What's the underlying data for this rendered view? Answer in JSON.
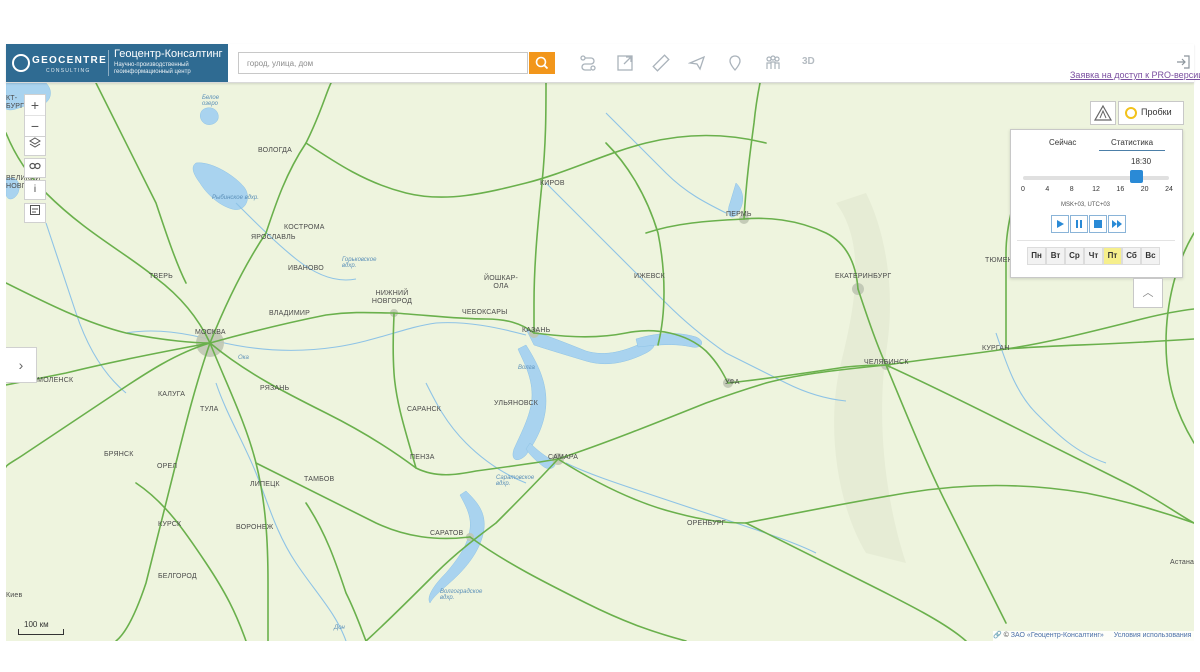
{
  "header": {
    "logo_word": "GEOCENTRE",
    "logo_sub": "CONSULTING",
    "company_name": "Геоцентр-Консалтинг",
    "company_desc": "Научно-производственный геоинформационный центр",
    "search_placeholder": "город, улица, дом",
    "tool_3d": "3D",
    "pro_link": "Заявка на доступ к PRO-версии"
  },
  "traffic": {
    "button_label": "Пробки",
    "tabs": [
      "Сейчас",
      "Статистика"
    ],
    "active_tab": "Статистика",
    "time": "18:30",
    "hour_value": 18.5,
    "hour_ticks": [
      "0",
      "4",
      "8",
      "12",
      "16",
      "20",
      "24"
    ],
    "timezone": "MSK+03, UTC+03",
    "days": [
      "Пн",
      "Вт",
      "Ср",
      "Чт",
      "Пт",
      "Сб",
      "Вс"
    ],
    "active_day": "Пт"
  },
  "map": {
    "scale_label": "100 км",
    "attribution": "ЗАО «Геоцентр-Консалтинг»",
    "terms": "Условия использования",
    "colors": {
      "land": "#eef4de",
      "water": "#a9d3ef",
      "road": "#6ab04c",
      "city": "#bfc6b3"
    },
    "cities": {
      "vologda": "ВОЛОГДА",
      "kirov": "КИРОВ",
      "perm": "ПЕРМЬ",
      "kostroma": "КОСТРОМА",
      "yaroslavl": "ЯРОСЛАВЛЬ",
      "ivanovo": "ИВАНОВО",
      "tver": "ТВЕРЬ",
      "nizhny": "НИЖНИЙ НОВГОРОД",
      "yoshkar": "ЙОШКАР-ОЛА",
      "cheboksary": "ЧЕБОКСАРЫ",
      "izhevsk": "ИЖЕВСК",
      "ekaterinburg": "ЕКАТЕРИНБУРГ",
      "tyumen": "ТЮМЕНЬ",
      "moscow": "МОСКВА",
      "vladimir": "ВЛАДИМИР",
      "kazan": "КАЗАНЬ",
      "kurgan": "КУРГАН",
      "ufa": "УФА",
      "chelyabinsk": "ЧЕЛЯБИНСК",
      "smolensk": "СМОЛЕНСК",
      "ryazan": "РЯЗАНЬ",
      "kaluga": "КАЛУГА",
      "tula": "ТУЛА",
      "saransk": "САРАНСК",
      "ulyanovsk": "УЛЬЯНОВСК",
      "bryansk": "БРЯНСК",
      "penza": "ПЕНЗА",
      "samara": "САМАРА",
      "orel": "ОРЕЛ",
      "lipetsk": "ЛИПЕЦК",
      "tambov": "ТАМБОВ",
      "orenburg": "ОРЕНБУРГ",
      "kursk": "КУРСК",
      "voronezh": "ВОРОНЕЖ",
      "saratov": "САРАТОВ",
      "belgorod": "БЕЛГОРОД",
      "astana": "Астана",
      "kiev": "Киев",
      "velikiy": "ВЕЛИКИЙ НОВГОРОД",
      "spb": "КТ-БУРГ"
    },
    "water_labels": {
      "beloe": "Белое озеро",
      "rybinsk": "Рыбинское вдхр.",
      "gorkovskoe": "Горьковское вдхр.",
      "saratovskoe": "Саратовское вдхр.",
      "volgogradskoe": "Волгоградское вдхр.",
      "volga": "Волга",
      "don": "Дон",
      "oka": "Ока"
    }
  }
}
